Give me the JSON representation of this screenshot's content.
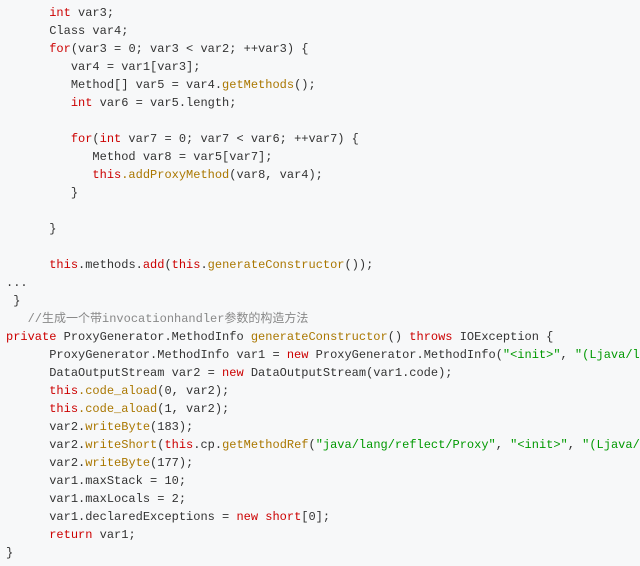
{
  "code": {
    "l1": "int",
    "l1b": " var3;",
    "l2": "Class var4;",
    "l3a": "for",
    "l3b": "(var3 = 0; var3 < var2; ++var3) {",
    "l4": "var4 = var1[var3];",
    "l5a": "Method[] var5 = var4.",
    "l5m": "getMethods",
    "l5b": "();",
    "l6a": "int",
    "l6b": " var6 = var5.length;",
    "l7a": "for",
    "l7b": "(",
    "l7c": "int",
    "l7d": " var7 = 0; var7 < var6; ++var7) {",
    "l8": "Method var8 = var5[var7];",
    "l9a": "this",
    "l9m": ".addProxyMethod",
    "l9b": "(var8, var4);",
    "l10": "}",
    "l11": "}",
    "l12a": "this",
    "l12b": ".methods.",
    "l12c": "add",
    "l12d": "(",
    "l12e": "this",
    "l12f": ".",
    "l12m": "generateConstructor",
    "l12g": "());",
    "l13": "...",
    "l14": "}",
    "l15": "//生成一个带invocationhandler参数的构造方法",
    "l16a": "private",
    "l16b": " ProxyGenerator.MethodInfo ",
    "l16m": "generateConstructor",
    "l16c": "() ",
    "l16d": "throws",
    "l16e": " IOException {",
    "l17a": "ProxyGenerator.MethodInfo var1 = ",
    "l17b": "new",
    "l17c": " ProxyGenerator.MethodInfo(",
    "l17s1": "\"<init>\"",
    "l17d": ", ",
    "l17s2": "\"(Ljava/lang/reflect/InvocationHand",
    "l18a": "DataOutputStream var2 = ",
    "l18b": "new",
    "l18c": " DataOutputStream(var1.code);",
    "l19a": "this",
    "l19m": ".code_aload",
    "l19b": "(0, var2);",
    "l20a": "this",
    "l20m": ".code_aload",
    "l20b": "(1, var2);",
    "l21a": "var2.",
    "l21m": "writeByte",
    "l21b": "(183);",
    "l22a": "var2.",
    "l22m": "writeShort",
    "l22b": "(",
    "l22c": "this",
    "l22d": ".cp.",
    "l22m2": "getMethodRef",
    "l22e": "(",
    "l22s1": "\"java/lang/reflect/Proxy\"",
    "l22f": ", ",
    "l22s2": "\"<init>\"",
    "l22g": ", ",
    "l22s3": "\"(Ljava/lang/reflect/InvocationHan",
    "l23a": "var2.",
    "l23m": "writeByte",
    "l23b": "(177);",
    "l24": "var1.maxStack = 10;",
    "l25": "var1.maxLocals = 2;",
    "l26a": "var1.declaredExceptions = ",
    "l26b": "new",
    "l26c": " ",
    "l26d": "short",
    "l26e": "[0];",
    "l27a": "return",
    "l27b": " var1;",
    "l28": "}"
  }
}
